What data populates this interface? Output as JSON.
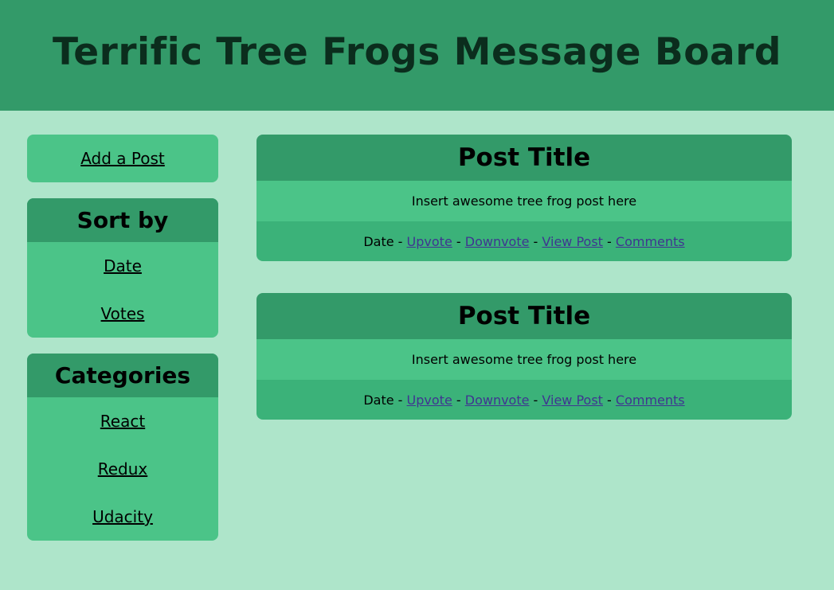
{
  "header": {
    "title": "Terrific Tree Frogs Message Board"
  },
  "sidebar": {
    "add_post_label": "Add a Post",
    "sort": {
      "title": "Sort by",
      "items": [
        "Date",
        "Votes"
      ]
    },
    "categories": {
      "title": "Categories",
      "items": [
        "React",
        "Redux",
        "Udacity"
      ]
    }
  },
  "posts": [
    {
      "title": "Post Title",
      "body": "Insert awesome tree frog post here",
      "date": "Date",
      "separator": " - ",
      "upvote": "Upvote",
      "downvote": "Downvote",
      "view": "View Post",
      "comments": "Comments"
    },
    {
      "title": "Post Title",
      "body": "Insert awesome tree frog post here",
      "date": "Date",
      "separator": " - ",
      "upvote": "Upvote",
      "downvote": "Downvote",
      "view": "View Post",
      "comments": "Comments"
    }
  ],
  "colors": {
    "page_bg": "#aee5ca",
    "header_bg": "#339a69",
    "header_text": "#0b2d1d",
    "panel_bg": "#4bc488",
    "footer_bg": "#3bb279",
    "link": "#3f3591"
  }
}
